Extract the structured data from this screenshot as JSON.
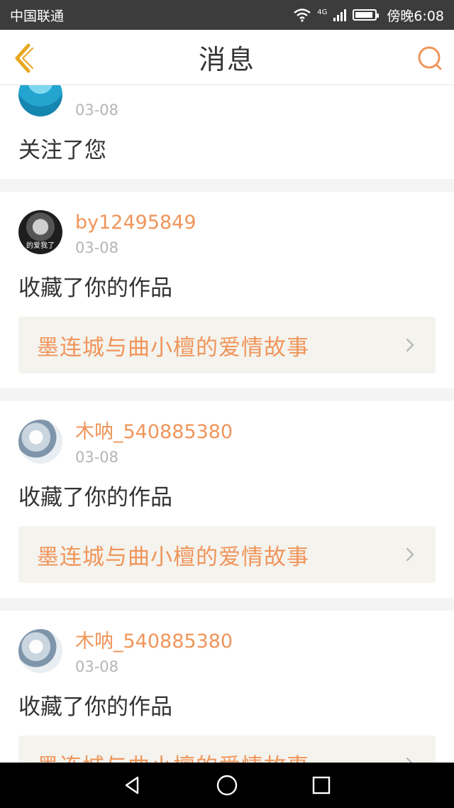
{
  "status_bar": {
    "carrier": "中国联通",
    "network": "4G",
    "time": "傍晚6:08"
  },
  "header": {
    "title": "消息"
  },
  "messages": [
    {
      "date": "03-08",
      "action": "关注了您"
    },
    {
      "username": "by12495849",
      "avatar_caption": "的爱我了",
      "date": "03-08",
      "action": "收藏了你的作品",
      "work_title": "墨连城与曲小檀的爱情故事"
    },
    {
      "username": "木呐_540885380",
      "date": "03-08",
      "action": "收藏了你的作品",
      "work_title": "墨连城与曲小檀的爱情故事"
    },
    {
      "username": "木呐_540885380",
      "date": "03-08",
      "action": "收藏了你的作品",
      "work_title": "墨连城与曲小檀的爱情故事"
    }
  ],
  "colors": {
    "accent": "#f0955a",
    "status_bar": "#3c3c3c",
    "work_bg": "#f4f3ee"
  },
  "icons": [
    "back-icon",
    "search-icon",
    "chevron-right-icon",
    "nav-back-icon",
    "nav-home-icon",
    "nav-recents-icon",
    "wifi-icon",
    "signal-icon",
    "battery-icon"
  ]
}
